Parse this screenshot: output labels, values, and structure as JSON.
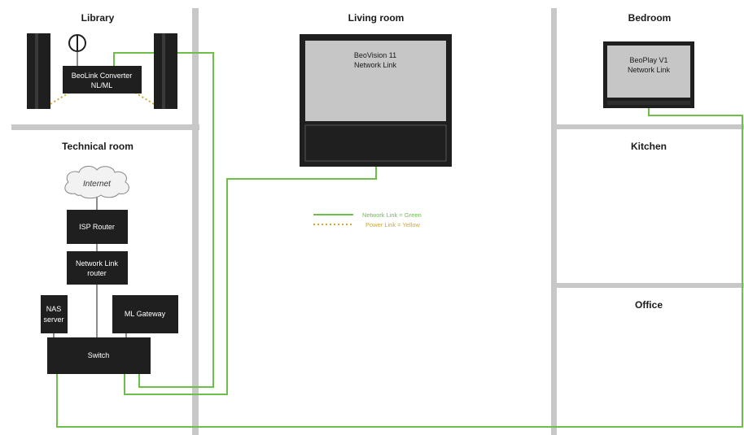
{
  "rooms": {
    "library": "Library",
    "living_room": "Living room",
    "bedroom": "Bedroom",
    "technical_room": "Technical room",
    "kitchen": "Kitchen",
    "office": "Office"
  },
  "devices": {
    "beolink_converter": {
      "line1": "BeoLink Converter",
      "line2": "NL/ML"
    },
    "beovision": {
      "line1": "BeoVision 11",
      "line2": "Network Link"
    },
    "beoplay": {
      "line1": "BeoPlay V1",
      "line2": "Network Link"
    },
    "internet": "Internet",
    "isp_router": "ISP Router",
    "network_link_router": {
      "line1": "Network Link",
      "line2": "router"
    },
    "nas_server": {
      "line1": "NAS",
      "line2": "server"
    },
    "ml_gateway": "ML Gateway",
    "switch": "Switch"
  },
  "legend": {
    "network_link": "Network Link = Green",
    "power_link": "Power Link = Yellow"
  },
  "colors": {
    "network_link": "#6cc04a",
    "power_link": "#d4a82a",
    "walls": "#c8c8c8",
    "device": "#1f1f1f",
    "screen": "#c6c6c6",
    "cable": "#666666"
  }
}
